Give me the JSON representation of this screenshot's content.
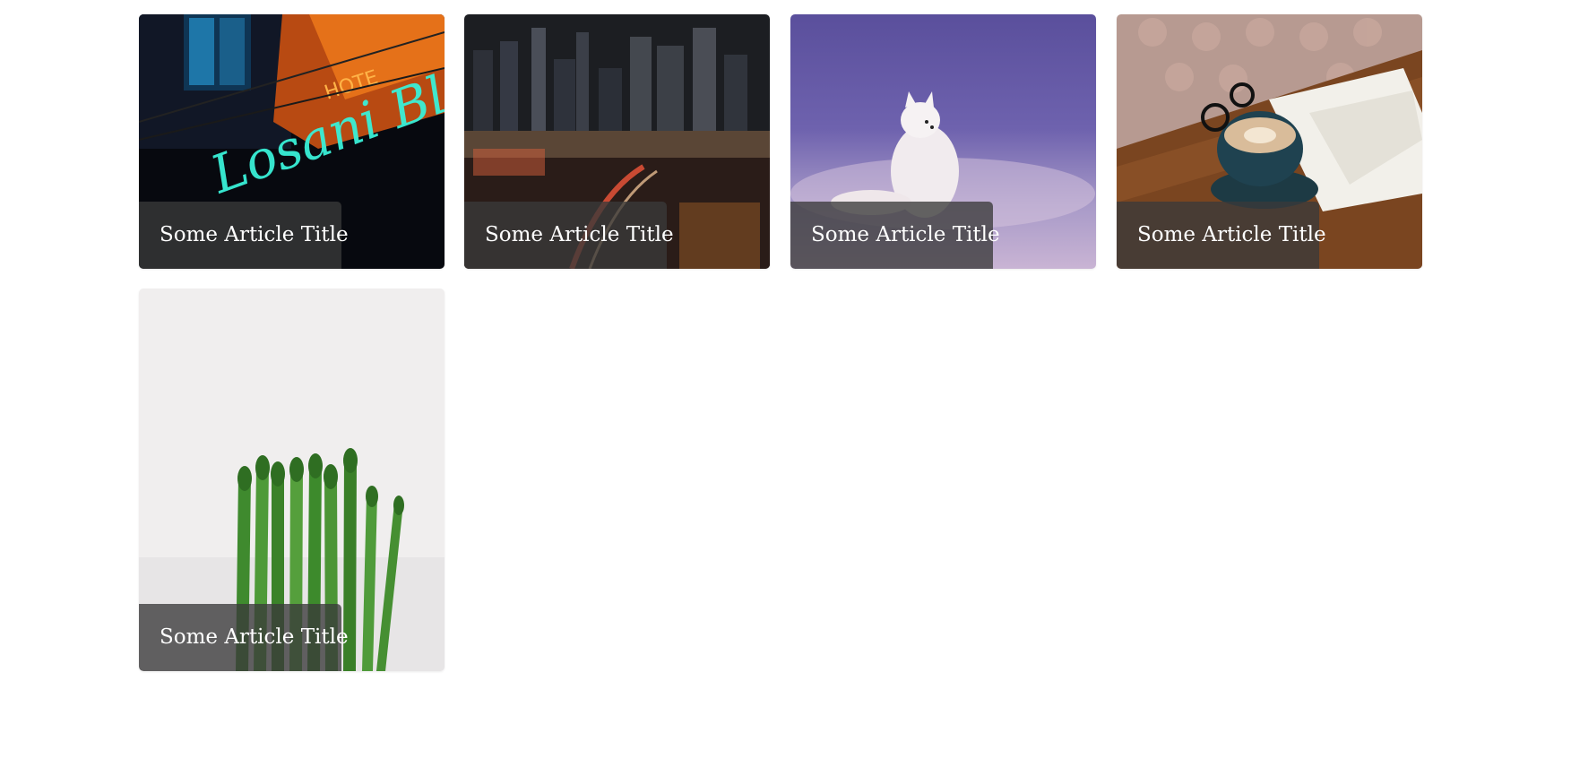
{
  "articles": [
    {
      "title": "Some Article Title",
      "image": "neon-hotel-sign-photo"
    },
    {
      "title": "Some Article Title",
      "image": "city-skyline-night-photo"
    },
    {
      "title": "Some Article Title",
      "image": "arctic-fox-snow-photo"
    },
    {
      "title": "Some Article Title",
      "image": "coffee-and-book-photo"
    },
    {
      "title": "Some Article Title",
      "image": "asparagus-photo"
    }
  ]
}
